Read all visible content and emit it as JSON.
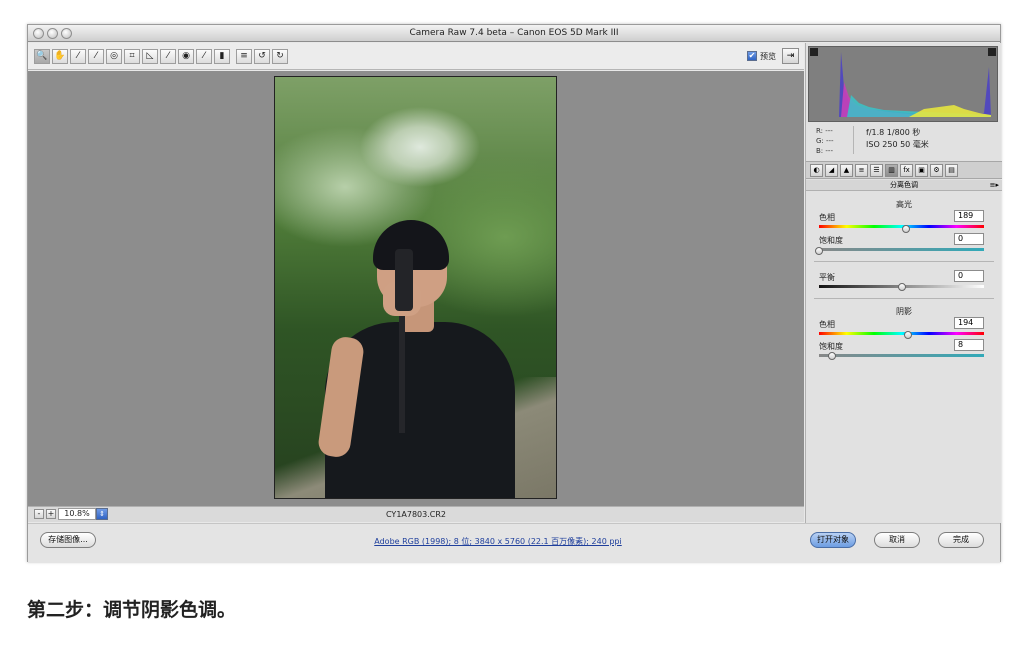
{
  "window": {
    "title": "Camera Raw 7.4 beta –  Canon EOS 5D Mark III"
  },
  "toolbar": {
    "tools": [
      {
        "name": "zoom-tool",
        "glyph": "🔍"
      },
      {
        "name": "hand-tool",
        "glyph": "✋"
      },
      {
        "name": "white-balance-tool",
        "glyph": "⁄"
      },
      {
        "name": "color-sampler-tool",
        "glyph": "⁄"
      },
      {
        "name": "targeted-adjustment-tool",
        "glyph": "◎"
      },
      {
        "name": "crop-tool",
        "glyph": "⌗"
      },
      {
        "name": "straighten-tool",
        "glyph": "◺"
      },
      {
        "name": "spot-removal-tool",
        "glyph": "⁄"
      },
      {
        "name": "red-eye-tool",
        "glyph": "◉"
      },
      {
        "name": "adjustment-brush-tool",
        "glyph": "⁄"
      },
      {
        "name": "graduated-filter-tool",
        "glyph": "▮"
      },
      {
        "name": "preferences-tool",
        "glyph": "≡"
      },
      {
        "name": "rotate-left-tool",
        "glyph": "↺"
      },
      {
        "name": "rotate-right-tool",
        "glyph": "↻"
      }
    ],
    "preview_label": "预览",
    "preview_checked": "✔",
    "fullscreen_glyph": "⇥"
  },
  "statusbar": {
    "zoom_minus": "-",
    "zoom_plus": "+",
    "zoom_value": "10.8%",
    "zoom_stepper": "⇕",
    "filename": "CY1A7803.CR2"
  },
  "footer": {
    "save_label": "存储图像...",
    "workflow_link": "Adobe RGB (1998); 8 位; 3840 x 5760 (22.1 百万像素); 240 ppi",
    "open_label": "打开对象",
    "cancel_label": "取消",
    "done_label": "完成"
  },
  "info": {
    "r": "R:  ---",
    "g": "G:  ---",
    "b": "B:  ---",
    "aperture_shutter": "f/1.8    1/800 秒",
    "iso_focal": "ISO 250    50 毫米"
  },
  "panel": {
    "tabs": [
      "◐",
      "◢",
      "▲",
      "≡",
      "☰",
      "▥",
      "fx",
      "▣",
      "⚙",
      "▤"
    ],
    "title": "分离色调",
    "menu_glyph": "≡▸",
    "highlights": {
      "label": "高光",
      "hue_label": "色相",
      "hue_value": "189",
      "hue": 189,
      "saturation_label": "饱和度",
      "saturation_value": "0",
      "saturation": 0
    },
    "balance": {
      "label": "平衡",
      "value": "0",
      "position": 0
    },
    "shadows": {
      "label": "阴影",
      "hue_label": "色相",
      "hue_value": "194",
      "hue": 194,
      "saturation_label": "饱和度",
      "saturation_value": "8",
      "saturation": 8
    }
  },
  "caption": "第二步：调节阴影色调。"
}
